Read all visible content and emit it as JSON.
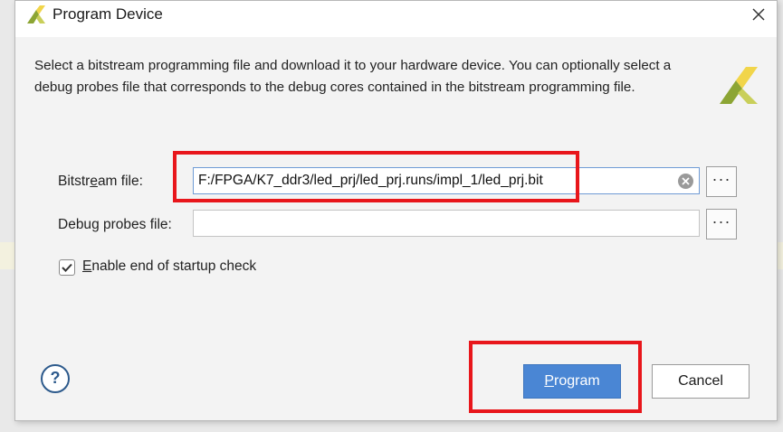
{
  "window": {
    "title": "Program Device",
    "logo_icon": "xilinx-logo-icon",
    "close_icon": "close-icon"
  },
  "description": "Select a bitstream programming file and download it to your hardware device. You can optionally select a debug probes file that corresponds to the debug cores contained in the bitstream programming file.",
  "fields": {
    "bitstream": {
      "label_pre": "Bitstr",
      "label_mnemonic": "e",
      "label_post": "am file:",
      "value": "F:/FPGA/K7_ddr3/led_prj/led_prj.runs/impl_1/led_prj.bit",
      "browse_label": "···"
    },
    "debug_probes": {
      "label_pre": "Debu",
      "label_mnemonic": "g",
      "label_post": " probes file:",
      "value": "",
      "browse_label": "···"
    }
  },
  "startup_check": {
    "checked": true,
    "label_mnemonic": "E",
    "label_post": "nable end of startup check"
  },
  "buttons": {
    "help_label": "?",
    "program_mnemonic": "P",
    "program_post": "rogram",
    "cancel_label": "Cancel"
  },
  "colors": {
    "accent": "#4a86d4",
    "annotation": "#e8161b",
    "logo_green": "#8ca534",
    "logo_yellow": "#f1d54a"
  }
}
